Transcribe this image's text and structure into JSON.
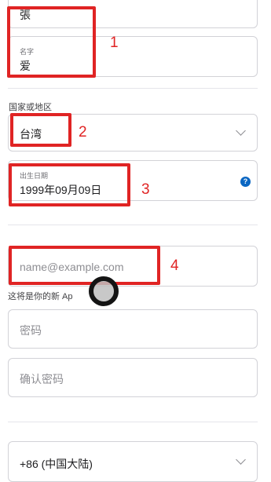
{
  "surname_value": "張",
  "given_name": {
    "label": "名字",
    "value": "爱"
  },
  "country": {
    "label": "国家或地区",
    "value": "台湾"
  },
  "birthdate": {
    "label": "出生日期",
    "value": "1999年09月09日"
  },
  "email": {
    "placeholder": "name@example.com",
    "hint": "这将是你的新 Ap"
  },
  "password": {
    "placeholder": "密码"
  },
  "confirm_password": {
    "placeholder": "确认密码"
  },
  "phone_country": {
    "value": "+86 (中国大陆)"
  },
  "annotations": [
    "1",
    "2",
    "3",
    "4"
  ],
  "colors": {
    "annotation": "#e02424",
    "help_icon": "#0a66c2"
  },
  "icons": {
    "help": "question-mark-icon",
    "dropdown": "chevron-down-icon"
  }
}
